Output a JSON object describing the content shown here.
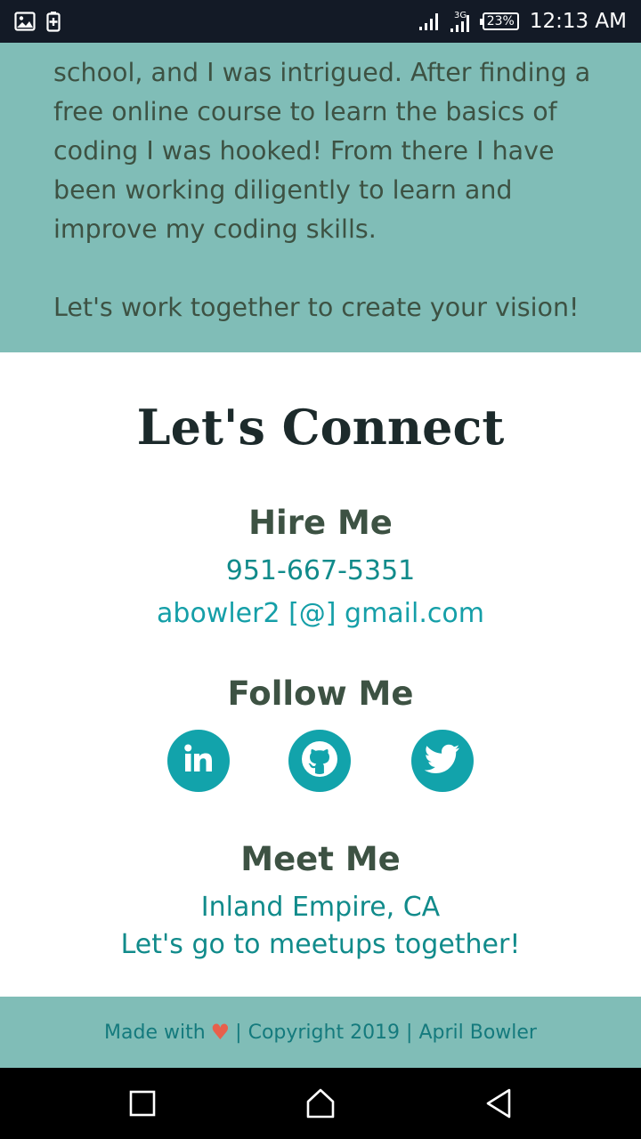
{
  "status_bar": {
    "battery": "23%",
    "time": "12:13 AM",
    "network": "3G",
    "icons": [
      "image-icon",
      "battery-saver-icon",
      "signal-icon",
      "signal-3g-icon",
      "battery-icon"
    ]
  },
  "about": {
    "partial_line": "school, and I was intrigued. After finding a",
    "lines": [
      "free online course to learn the basics of",
      "coding I was hooked! From there I have",
      "been working diligently to learn and",
      "improve my coding skills."
    ],
    "cta": "Let's work together to create your vision!"
  },
  "connect": {
    "title": "Let's Connect",
    "hire": {
      "heading": "Hire Me",
      "phone": "951-667-5351",
      "email": "abowler2 [@] gmail.com"
    },
    "follow": {
      "heading": "Follow Me",
      "links": [
        "linkedin-icon",
        "github-icon",
        "twitter-icon"
      ]
    },
    "meet": {
      "heading": "Meet Me",
      "location": "Inland Empire, CA",
      "tagline": "Let's go to meetups together!"
    }
  },
  "footer": {
    "made_with": "Made with",
    "heart": "♥",
    "rest": "| Copyright 2019 | April Bowler"
  },
  "colors": {
    "teal_bg": "#80bdb7",
    "accent": "#12a3ab",
    "heading": "#3d5243",
    "heart": "#e8604c"
  }
}
